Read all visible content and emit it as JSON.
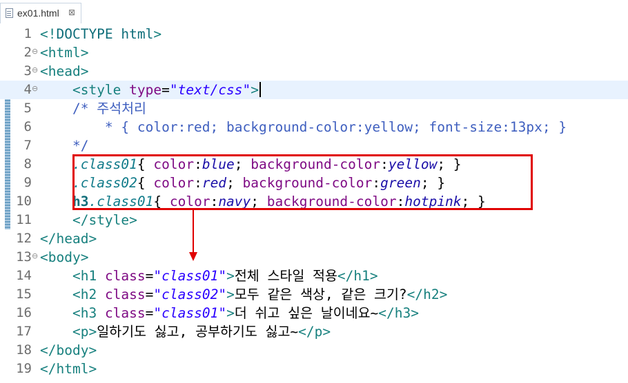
{
  "tab": {
    "label": "ex01.html",
    "close_glyph": "⊠"
  },
  "lines": [
    {
      "num": "1"
    },
    {
      "num": "2",
      "fold": "⊖"
    },
    {
      "num": "3",
      "fold": "⊖"
    },
    {
      "num": "4",
      "fold": "⊖"
    },
    {
      "num": "5"
    },
    {
      "num": "6"
    },
    {
      "num": "7"
    },
    {
      "num": "8"
    },
    {
      "num": "9"
    },
    {
      "num": "10"
    },
    {
      "num": "11"
    },
    {
      "num": "12"
    },
    {
      "num": "13",
      "fold": "⊖"
    },
    {
      "num": "14"
    },
    {
      "num": "15"
    },
    {
      "num": "16"
    },
    {
      "num": "17"
    },
    {
      "num": "18"
    },
    {
      "num": "19"
    }
  ],
  "code": {
    "l1": {
      "open": "<!",
      "doctype": "DOCTYPE",
      "html": " html",
      "close": ">"
    },
    "l2": {
      "tag": "<html>"
    },
    "l3": {
      "tag": "<head>"
    },
    "l4": {
      "indent": "    ",
      "open": "<style",
      "attr": " type",
      "eq": "=",
      "val": "\"text/css\"",
      "close": ">"
    },
    "l5": {
      "indent": "    ",
      "text": "/* 주석처리"
    },
    "l6": {
      "indent": "        ",
      "text": "* { color:red; background-color:yellow; font-size:13px; }"
    },
    "l7": {
      "indent": "    ",
      "text": "*/"
    },
    "l8": {
      "indent": "    ",
      "sel": ".class01",
      "b1": "{ ",
      "p1": "color",
      "c1": ":",
      "v1": "blue",
      "s1": "; ",
      "p2": "background-color",
      "c2": ":",
      "v2": "yellow",
      "end": "; }"
    },
    "l9": {
      "indent": "    ",
      "sel": ".class02",
      "b1": "{ ",
      "p1": "color",
      "c1": ":",
      "v1": "red",
      "s1": "; ",
      "p2": "background-color",
      "c2": ":",
      "v2": "green",
      "end": "; }"
    },
    "l10": {
      "indent": "    ",
      "tagsel": "h3",
      "sel": ".class01",
      "b1": "{ ",
      "p1": "color",
      "c1": ":",
      "v1": "navy",
      "s1": "; ",
      "p2": "background-color",
      "c2": ":",
      "v2": "hotpink",
      "end": "; }"
    },
    "l11": {
      "indent": "    ",
      "tag": "</style>"
    },
    "l12": {
      "tag": "</head>"
    },
    "l13": {
      "tag": "<body>"
    },
    "l14": {
      "indent": "    ",
      "open": "<h1",
      "attr": " class",
      "eq": "=",
      "val": "\"class01\"",
      "gt": ">",
      "text": "전체 스타일 적용",
      "close": "</h1>"
    },
    "l15": {
      "indent": "    ",
      "open": "<h2",
      "attr": " class",
      "eq": "=",
      "val": "\"class02\"",
      "gt": ">",
      "text": "모두 같은 색상, 같은 크기?",
      "close": "</h2>"
    },
    "l16": {
      "indent": "    ",
      "open": "<h3",
      "attr": " class",
      "eq": "=",
      "val": "\"class01\"",
      "gt": ">",
      "text": "더 쉬고 싶은 날이네요~",
      "close": "</h3>"
    },
    "l17": {
      "indent": "    ",
      "open": "<p>",
      "text": "일하기도 싫고, 공부하기도 싫고~",
      "close": "</p>"
    },
    "l18": {
      "tag": "</body>"
    },
    "l19": {
      "tag": "</html>"
    }
  },
  "colors": {
    "highlight_box": "#e00000",
    "tag": "#17807e",
    "attr": "#7f0b84",
    "value": "#2a00ff",
    "comment": "#3f5fbf"
  }
}
